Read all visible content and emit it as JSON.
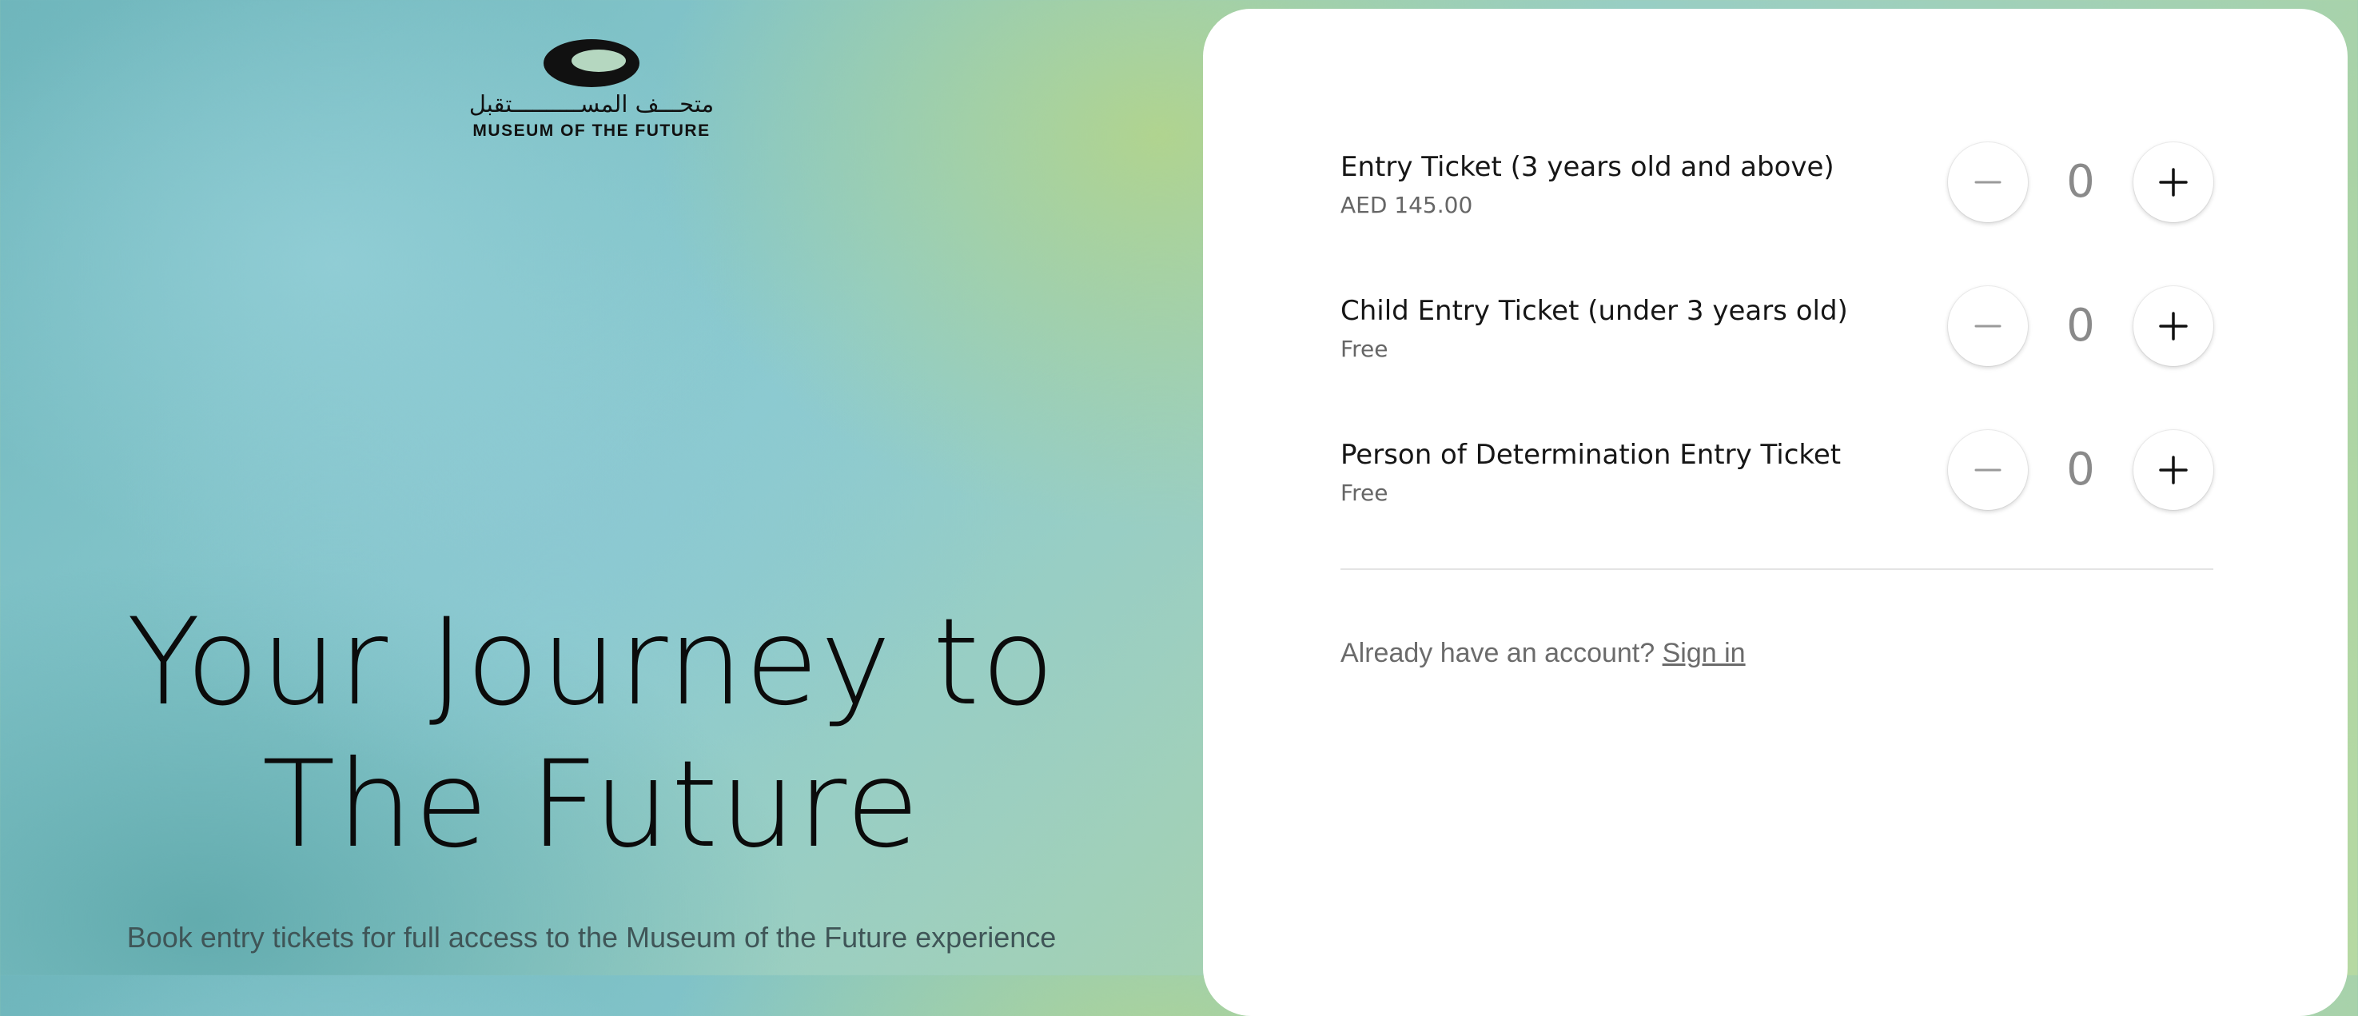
{
  "brand": {
    "arabic_name": "متحـــف المســــــــــتقبل",
    "english_name": "MUSEUM OF THE FUTURE"
  },
  "hero": {
    "title_line1": "Your Journey to",
    "title_line2": "The Future",
    "subtitle": "Book entry tickets for full access to the Museum of the Future experience"
  },
  "tickets": [
    {
      "name": "Entry Ticket (3 years old and above)",
      "price": "AED 145.00",
      "quantity": "0"
    },
    {
      "name": "Child Entry Ticket (under 3 years old)",
      "price": "Free",
      "quantity": "0"
    },
    {
      "name": "Person of Determination Entry Ticket",
      "price": "Free",
      "quantity": "0"
    }
  ],
  "account": {
    "prompt": "Already have an account?",
    "signin_label": "Sign in"
  },
  "icons": {
    "decrement": "minus-icon",
    "increment": "plus-icon",
    "logo": "museum-logo-icon"
  },
  "colors": {
    "card_background": "#ffffff",
    "text_primary": "#161616",
    "text_secondary": "#666666",
    "stepper_value": "#8a8a8a"
  }
}
